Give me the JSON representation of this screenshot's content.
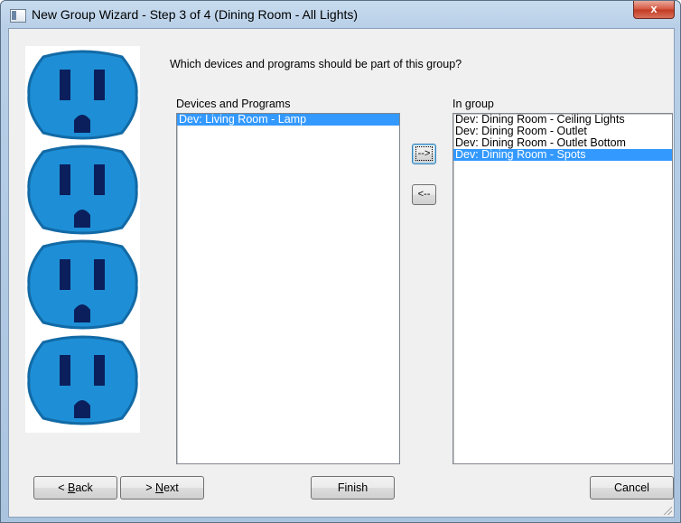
{
  "window": {
    "title": "New Group Wizard - Step 3 of 4 (Dining Room - All Lights)",
    "close_label": "x"
  },
  "prompt": "Which devices and programs should be part of this group?",
  "available": {
    "label": "Devices and Programs",
    "items": [
      "Dev: Living Room - Lamp"
    ],
    "selected_index": 0
  },
  "ingroup": {
    "label": "In group",
    "items": [
      "Dev: Dining Room - Ceiling Lights",
      "Dev: Dining Room - Outlet",
      "Dev: Dining Room - Outlet Bottom",
      "Dev: Dining Room - Spots"
    ],
    "selected_index": 3
  },
  "buttons": {
    "add": "-->",
    "remove": "<--",
    "back_prefix": "< ",
    "back_mnemonic": "B",
    "back_rest": "ack",
    "next_prefix": "> ",
    "next_mnemonic": "N",
    "next_rest": "ext",
    "finish": "Finish",
    "cancel": "Cancel"
  },
  "colors": {
    "selection": "#3399ff",
    "outlet_face": "#1e8fd6",
    "outlet_slot": "#0a1f5c"
  },
  "illustration": {
    "icon": "electrical-outlet-icon",
    "count": 4
  }
}
